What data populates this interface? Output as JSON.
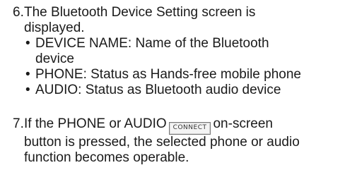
{
  "step6": {
    "number": "6.",
    "text_line1": "The Bluetooth Device Setting screen is",
    "text_line2": "displayed.",
    "bullets": [
      {
        "line1": "DEVICE NAME: Name of the Bluetooth",
        "line2": "device"
      },
      {
        "line1": "PHONE: Status as Hands-free mobile phone"
      },
      {
        "line1": "AUDIO: Status as Bluetooth audio device"
      }
    ]
  },
  "step7": {
    "number": "7.",
    "text_before_button": "If the PHONE or AUDIO",
    "button_label": "CONNECT",
    "text_after_button": "on-screen",
    "text_line2": "button is pressed, the selected phone or audio",
    "text_line3": "function becomes operable."
  },
  "bullet_glyph": "•"
}
